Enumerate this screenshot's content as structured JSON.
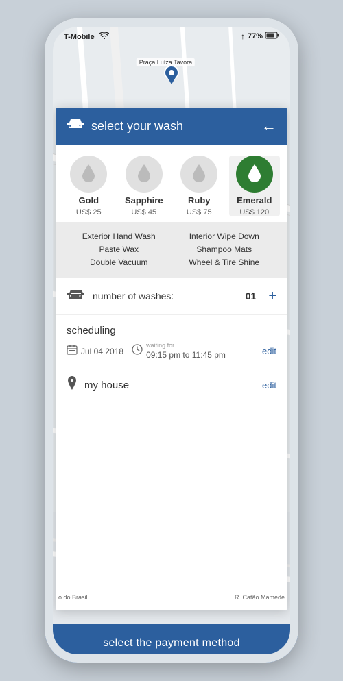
{
  "status_bar": {
    "carrier": "T-Mobile",
    "wifi": "📶",
    "battery": "77%",
    "signal": "↑"
  },
  "header": {
    "title": "select your wash",
    "back_arrow": "←",
    "car_icon": "🚗"
  },
  "wash_options": [
    {
      "id": "gold",
      "name": "Gold",
      "price": "US$ 25",
      "selected": false
    },
    {
      "id": "sapphire",
      "name": "Sapphire",
      "price": "US$ 45",
      "selected": false
    },
    {
      "id": "ruby",
      "name": "Ruby",
      "price": "US$ 75",
      "selected": false
    },
    {
      "id": "emerald",
      "name": "Emerald",
      "price": "US$ 120",
      "selected": true
    }
  ],
  "features": {
    "left": [
      "Exterior Hand Wash",
      "Paste Wax",
      "Double Vacuum"
    ],
    "right": [
      "Interior Wipe Down",
      "Shampoo Mats",
      "Wheel & Tire Shine"
    ]
  },
  "wash_count": {
    "label": "number of washes:",
    "value": "01",
    "plus": "+"
  },
  "scheduling": {
    "title": "scheduling",
    "date_icon": "📅",
    "date": "Jul 04 2018",
    "time_icon": "🕐",
    "waiting_for": "waiting for",
    "time_range": "09:15 pm to 11:45 pm",
    "edit": "edit"
  },
  "location": {
    "icon": "📍",
    "name": "my house",
    "edit": "edit"
  },
  "map": {
    "pin_label": "Praça Luíza Tavora",
    "street_left": "o do Brasil",
    "street_right": "R. Catão Mamede"
  },
  "bottom_button": {
    "label": "select the payment method"
  },
  "colors": {
    "brand_blue": "#2c5f9e",
    "emerald_green": "#2e7d32",
    "light_gray": "#e0e0e0",
    "feature_bg": "#ebebeb"
  }
}
